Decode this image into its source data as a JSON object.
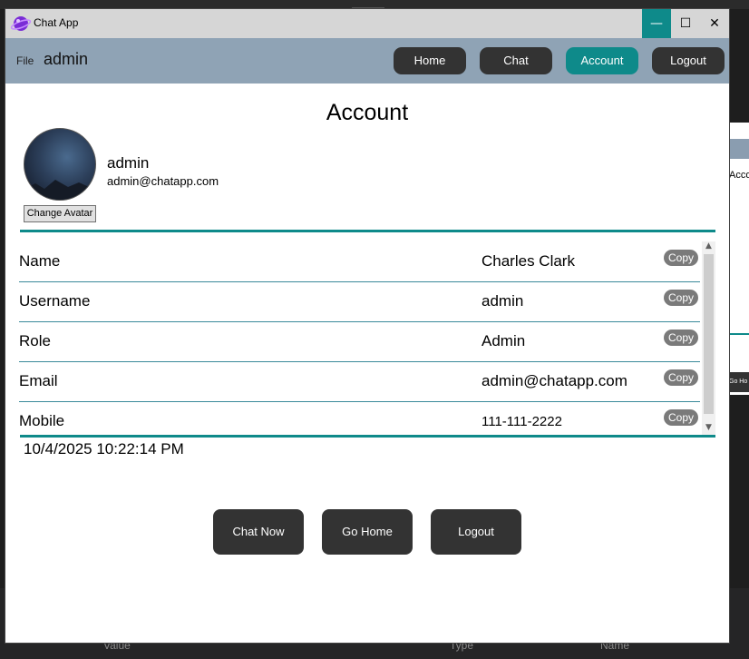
{
  "window": {
    "app_title": "Chat App",
    "min_glyph": "—",
    "max_glyph": "☐",
    "close_glyph": "✕"
  },
  "navbar": {
    "file_menu": "File",
    "username": "admin",
    "buttons": [
      {
        "label": "Home"
      },
      {
        "label": "Chat"
      },
      {
        "label": "Account",
        "active": true
      },
      {
        "label": "Logout"
      }
    ],
    "active_color": "#0e8a8a"
  },
  "page": {
    "title": "Account"
  },
  "profile": {
    "name": "admin",
    "email": "admin@chatapp.com",
    "change_avatar_label": "Change Avatar"
  },
  "details": {
    "copy_label": "Copy",
    "rows": [
      {
        "label": "Name",
        "value": "Charles Clark"
      },
      {
        "label": "Username",
        "value": "admin"
      },
      {
        "label": "Role",
        "value": "Admin"
      },
      {
        "label": "Email",
        "value": "admin@chatapp.com"
      },
      {
        "label": "Mobile",
        "value": "111-111-2222"
      }
    ]
  },
  "timestamp": "10/4/2025 10:22:14 PM",
  "actions": {
    "chat_now": "Chat Now",
    "go_home": "Go Home",
    "logout": "Logout"
  },
  "background": {
    "right_text": "Acco",
    "right_button": "Go Ho",
    "bottom_labels": [
      "Value",
      "Type",
      "Name"
    ]
  },
  "colors": {
    "accent": "#0e8a8a",
    "navbar": "#8fa3b5",
    "button": "#333333",
    "titlebar": "#d6d6d6"
  }
}
